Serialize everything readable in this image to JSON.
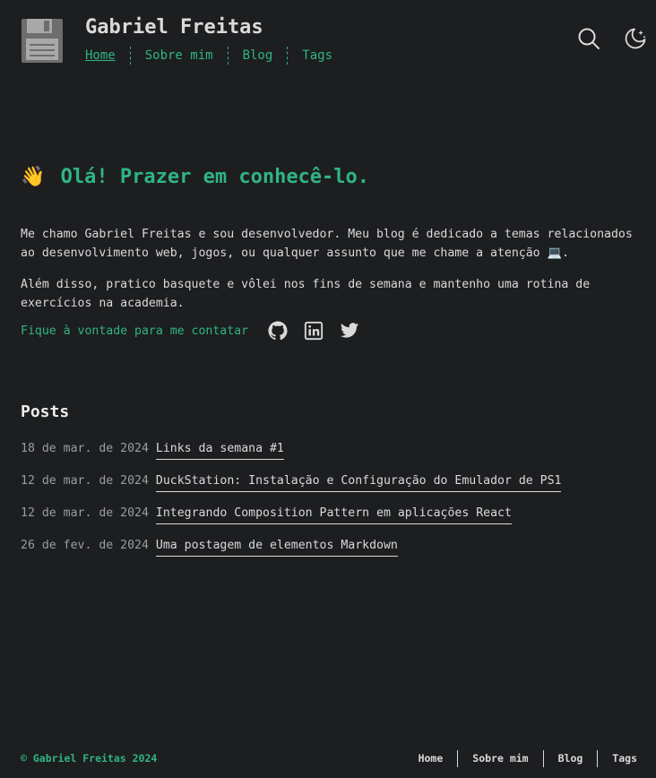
{
  "header": {
    "site_title": "Gabriel Freitas",
    "logo_icon": "floppy-disk-icon",
    "nav": [
      {
        "label": "Home"
      },
      {
        "label": "Sobre mim"
      },
      {
        "label": "Blog"
      },
      {
        "label": "Tags"
      }
    ],
    "search_icon": "search-icon",
    "theme_icon": "moon-icon"
  },
  "hero": {
    "wave_emoji": "👋",
    "title": "Olá! Prazer em conhecê-lo.",
    "paragraph1": "Me chamo Gabriel Freitas e sou desenvolvedor. Meu blog é dedicado a temas relacionados ao desenvolvimento web, jogos, ou qualquer assunto que me chame a atenção 💻.",
    "paragraph2": "Além disso, pratico basquete e vôlei nos fins de semana e mantenho uma rotina de exercícios na academia.",
    "contact_text": "Fique à vontade para me contatar",
    "social_icons": [
      "github-icon",
      "linkedin-icon",
      "twitter-icon"
    ]
  },
  "posts": {
    "title": "Posts",
    "items": [
      {
        "date": "18 de mar. de 2024",
        "title": "Links da semana #1"
      },
      {
        "date": "12 de mar. de 2024",
        "title": "DuckStation: Instalação e Configuração do Emulador de PS1"
      },
      {
        "date": "12 de mar. de 2024",
        "title": "Integrando Composition Pattern em aplicações React"
      },
      {
        "date": "26 de fev. de 2024",
        "title": "Uma postagem de elementos Markdown"
      }
    ]
  },
  "footer": {
    "copyright": "© Gabriel Freitas 2024",
    "nav": [
      {
        "label": "Home"
      },
      {
        "label": "Sobre mim"
      },
      {
        "label": "Blog"
      },
      {
        "label": "Tags"
      }
    ]
  },
  "colors": {
    "background": "#1d1e20",
    "accent": "#2fb486",
    "text": "#dadadb",
    "muted": "#9b9c9d"
  }
}
